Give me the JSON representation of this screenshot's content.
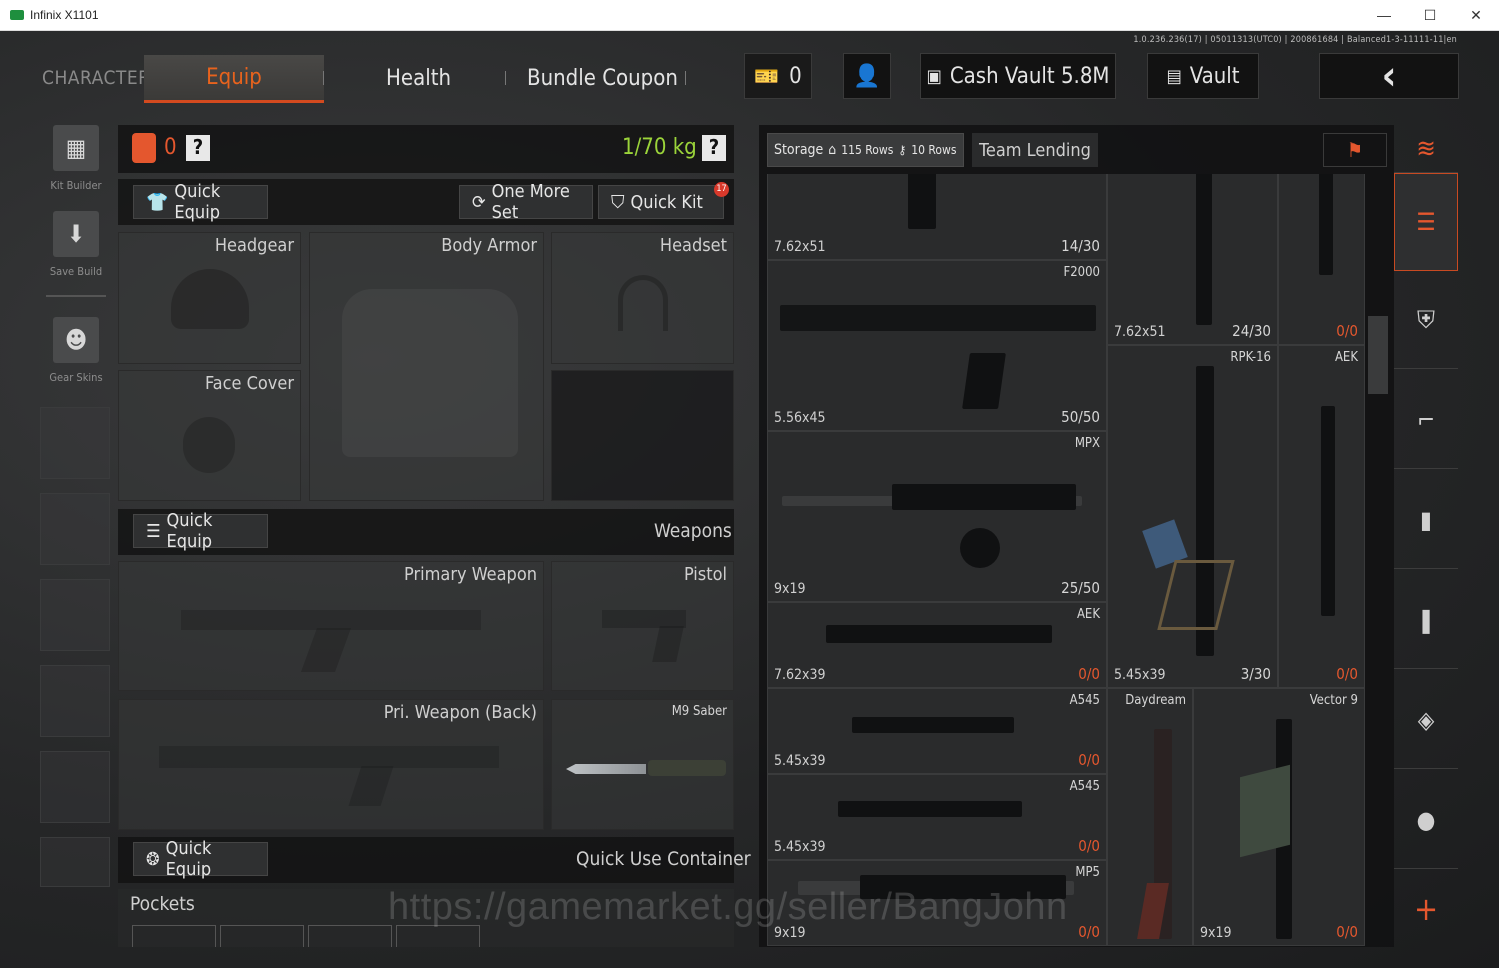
{
  "window": {
    "title": "Infinix X1101",
    "minimize": "—",
    "maximize": "☐",
    "close": "✕"
  },
  "version_text": "1.0.236.236(17) | 05011313(UTC0) | 200861684 | Balanced1-3-11111-11|en",
  "nav": {
    "character": "CHARACTER",
    "tabs": [
      "Equip",
      "Health",
      "Bundle Coupon"
    ],
    "coupon_count": "0",
    "cash_vault": "Cash Vault 5.8M",
    "vault": "Vault",
    "back_icon": "‹"
  },
  "sidebar": {
    "items": [
      {
        "label": "Kit Builder",
        "icon": "vest-icon"
      },
      {
        "label": "Save Build",
        "icon": "download-icon"
      },
      {
        "label": "Gear Skins",
        "icon": "mask-icon"
      }
    ]
  },
  "equip": {
    "container_count": "0",
    "help_icon": "?",
    "weight": "1/70 kg",
    "quick_equip": "Quick Equip",
    "one_more_set": "One More Set",
    "quick_kit": "Quick Kit",
    "quick_kit_badge": "17",
    "slots": {
      "headgear": "Headgear",
      "body_armor": "Body Armor",
      "headset": "Headset",
      "face_cover": "Face Cover"
    },
    "weapons": {
      "quick_equip": "Quick Equip",
      "title": "Weapons",
      "primary": "Primary Weapon",
      "pistol": "Pistol",
      "primary_back": "Pri. Weapon (Back)",
      "melee": "M9 Saber"
    },
    "quick_use": {
      "quick_equip": "Quick Equip",
      "title": "Quick Use Container"
    },
    "pockets": "Pockets"
  },
  "storage": {
    "storage_label": "Storage",
    "rows1": "115 Rows",
    "rows2": "10 Rows",
    "team_lending": "Team Lending",
    "items": [
      {
        "name": "",
        "caliber": "7.62x51",
        "ammo": "14/30",
        "zero": false
      },
      {
        "name": "F2000",
        "caliber": "5.56x45",
        "ammo": "50/50",
        "zero": false
      },
      {
        "name": "MPX",
        "caliber": "9x19",
        "ammo": "25/50",
        "zero": false
      },
      {
        "name": "AEK",
        "caliber": "7.62x39",
        "ammo": "0/0",
        "zero": true
      },
      {
        "name": "A545",
        "caliber": "5.45x39",
        "ammo": "0/0",
        "zero": true
      },
      {
        "name": "A545",
        "caliber": "5.45x39",
        "ammo": "0/0",
        "zero": true
      },
      {
        "name": "MP5",
        "caliber": "9x19",
        "ammo": "0/0",
        "zero": true
      },
      {
        "name": "",
        "caliber": "7.62x51",
        "ammo": "24/30",
        "zero": false
      },
      {
        "name": "",
        "caliber": "",
        "ammo": "0/0",
        "zero": true
      },
      {
        "name": "RPK-16",
        "caliber": "5.45x39",
        "ammo": "3/30",
        "zero": false
      },
      {
        "name": "AEK",
        "caliber": "",
        "ammo": "0/0",
        "zero": true
      },
      {
        "name": "Daydream",
        "caliber": "",
        "ammo": "",
        "zero": false
      },
      {
        "name": "Vector 9",
        "caliber": "9x19",
        "ammo": "0/0",
        "zero": true
      }
    ]
  },
  "right_tabs": [
    "layers-icon",
    "stack-icon",
    "armor-icon",
    "rifle-icon",
    "magazine-icon",
    "ammo-icon",
    "scope-icon",
    "grenade-icon",
    "add-icon"
  ],
  "watermark": "https://gamemarket.gg/seller/BangJohn",
  "colors": {
    "accent": "#e4572e",
    "weight_green": "#9bd43a"
  }
}
